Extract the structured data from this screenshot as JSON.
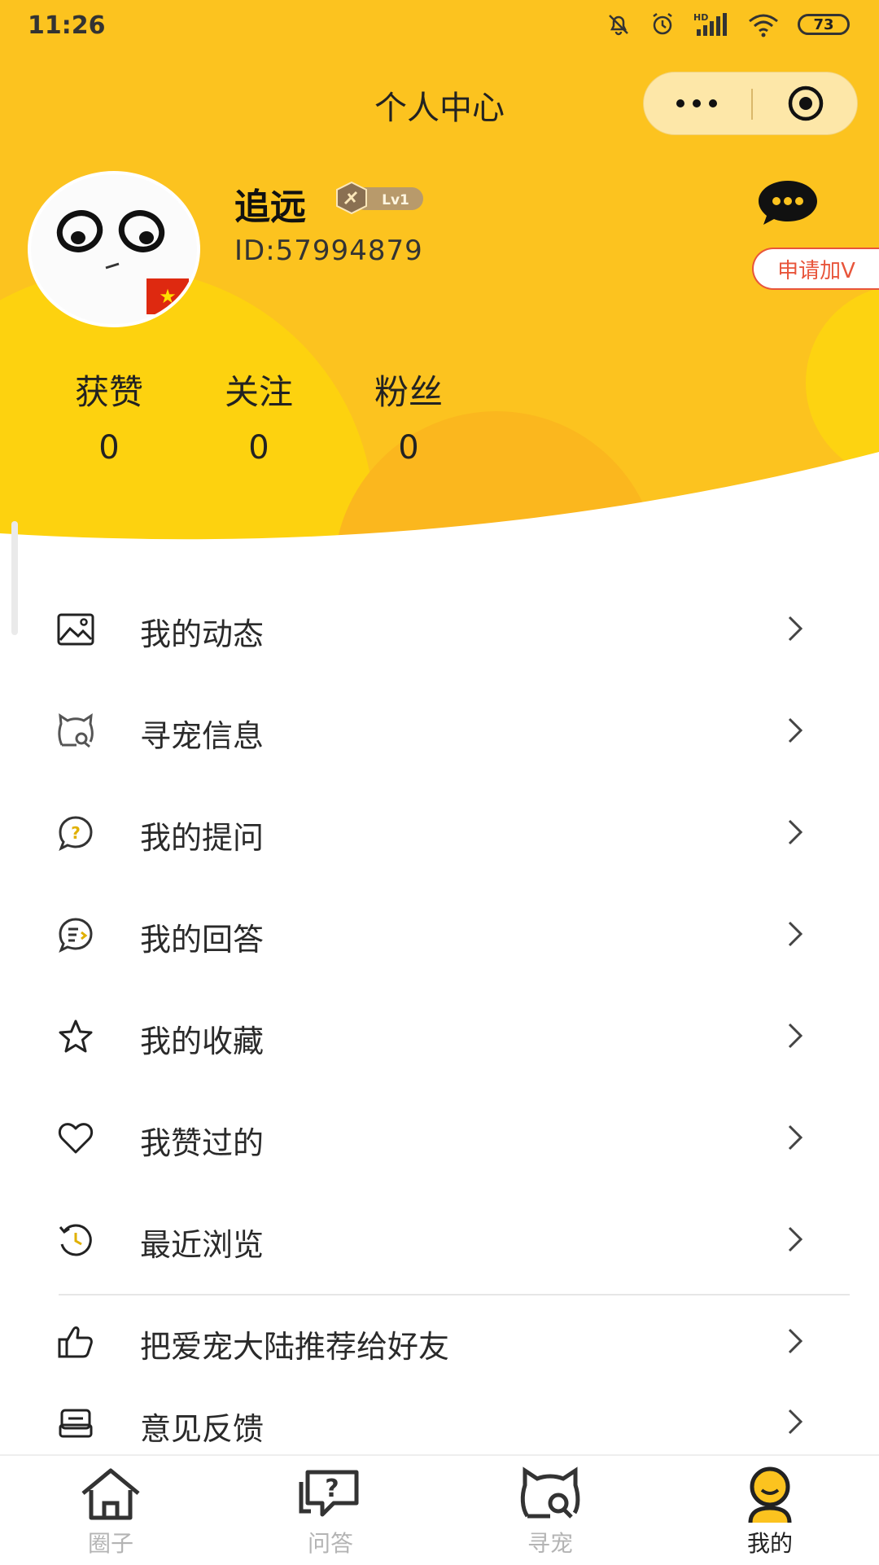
{
  "status_bar": {
    "time": "11:26",
    "battery": "73"
  },
  "nav": {
    "title": "个人中心"
  },
  "profile": {
    "username": "追远",
    "level": "Lv1",
    "user_id": "ID:57994879",
    "apply_v_label": "申请加V"
  },
  "stats": [
    {
      "label": "获赞",
      "value": "0"
    },
    {
      "label": "关注",
      "value": "0"
    },
    {
      "label": "粉丝",
      "value": "0"
    }
  ],
  "menu": [
    {
      "label": "我的动态",
      "icon": "image-icon"
    },
    {
      "label": "寻宠信息",
      "icon": "cat-search-icon"
    },
    {
      "label": "我的提问",
      "icon": "question-bubble-icon"
    },
    {
      "label": "我的回答",
      "icon": "answer-bubble-icon"
    },
    {
      "label": "我的收藏",
      "icon": "star-icon"
    },
    {
      "label": "我赞过的",
      "icon": "heart-icon"
    },
    {
      "label": "最近浏览",
      "icon": "history-icon"
    },
    {
      "label": "把爱宠大陆推荐给好友",
      "icon": "thumbs-up-icon"
    },
    {
      "label": "意见反馈",
      "icon": "feedback-icon"
    }
  ],
  "tabs": [
    {
      "label": "圈子",
      "icon": "home-icon"
    },
    {
      "label": "问答",
      "icon": "question-chat-icon"
    },
    {
      "label": "寻宠",
      "icon": "cat-search-icon"
    },
    {
      "label": "我的",
      "icon": "profile-icon",
      "active": true
    }
  ],
  "colors": {
    "brand_yellow": "#fcc31f",
    "accent_red": "#e8553b",
    "inactive_gray": "#b4b4b4"
  }
}
